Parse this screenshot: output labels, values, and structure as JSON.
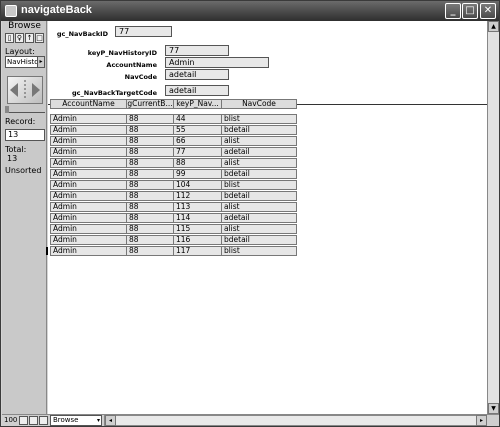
{
  "window": {
    "title": "navigateBack",
    "minimize": "_",
    "maximize": "□",
    "close": "✕"
  },
  "status_panel": {
    "mode_label": "Browse",
    "book_glyphs": [
      "▯",
      "♀",
      "↑",
      "□"
    ],
    "layout_label": "Layout:",
    "layout_value": "NavHisto",
    "layout_arrow": "▸",
    "record_label": "Record:",
    "record_value": "13",
    "total_label": "Total:",
    "total_value": "13",
    "sort_status": "Unsorted"
  },
  "header_fields": [
    {
      "label": "gc_NavBackID",
      "value": "77"
    },
    {
      "label": "keyP_NavHistoryID",
      "value": "77"
    },
    {
      "label": "AccountName",
      "value": "Admin"
    },
    {
      "label": "NavCode",
      "value": "adetail"
    },
    {
      "label": "gc_NavBackTargetCode",
      "value": "adetail"
    }
  ],
  "table": {
    "columns": [
      "AccountName",
      "gCurrentB...",
      "keyP_Nav...",
      "NavCode"
    ],
    "rows": [
      [
        "Admin",
        "88",
        "44",
        "blist"
      ],
      [
        "Admin",
        "88",
        "55",
        "bdetail"
      ],
      [
        "Admin",
        "88",
        "66",
        "alist"
      ],
      [
        "Admin",
        "88",
        "77",
        "adetail"
      ],
      [
        "Admin",
        "88",
        "88",
        "alist"
      ],
      [
        "Admin",
        "88",
        "99",
        "bdetail"
      ],
      [
        "Admin",
        "88",
        "104",
        "blist"
      ],
      [
        "Admin",
        "88",
        "112",
        "bdetail"
      ],
      [
        "Admin",
        "88",
        "113",
        "alist"
      ],
      [
        "Admin",
        "88",
        "114",
        "adetail"
      ],
      [
        "Admin",
        "88",
        "115",
        "alist"
      ],
      [
        "Admin",
        "88",
        "116",
        "bdetail"
      ],
      [
        "Admin",
        "88",
        "117",
        "blist"
      ]
    ],
    "current_row_index": 12
  },
  "bottom_bar": {
    "zoom": "100",
    "mode": "Browse",
    "mode_arrow": "▾"
  },
  "scrollbar": {
    "up": "▲",
    "down": "▼",
    "left": "◂",
    "right": "▸"
  }
}
